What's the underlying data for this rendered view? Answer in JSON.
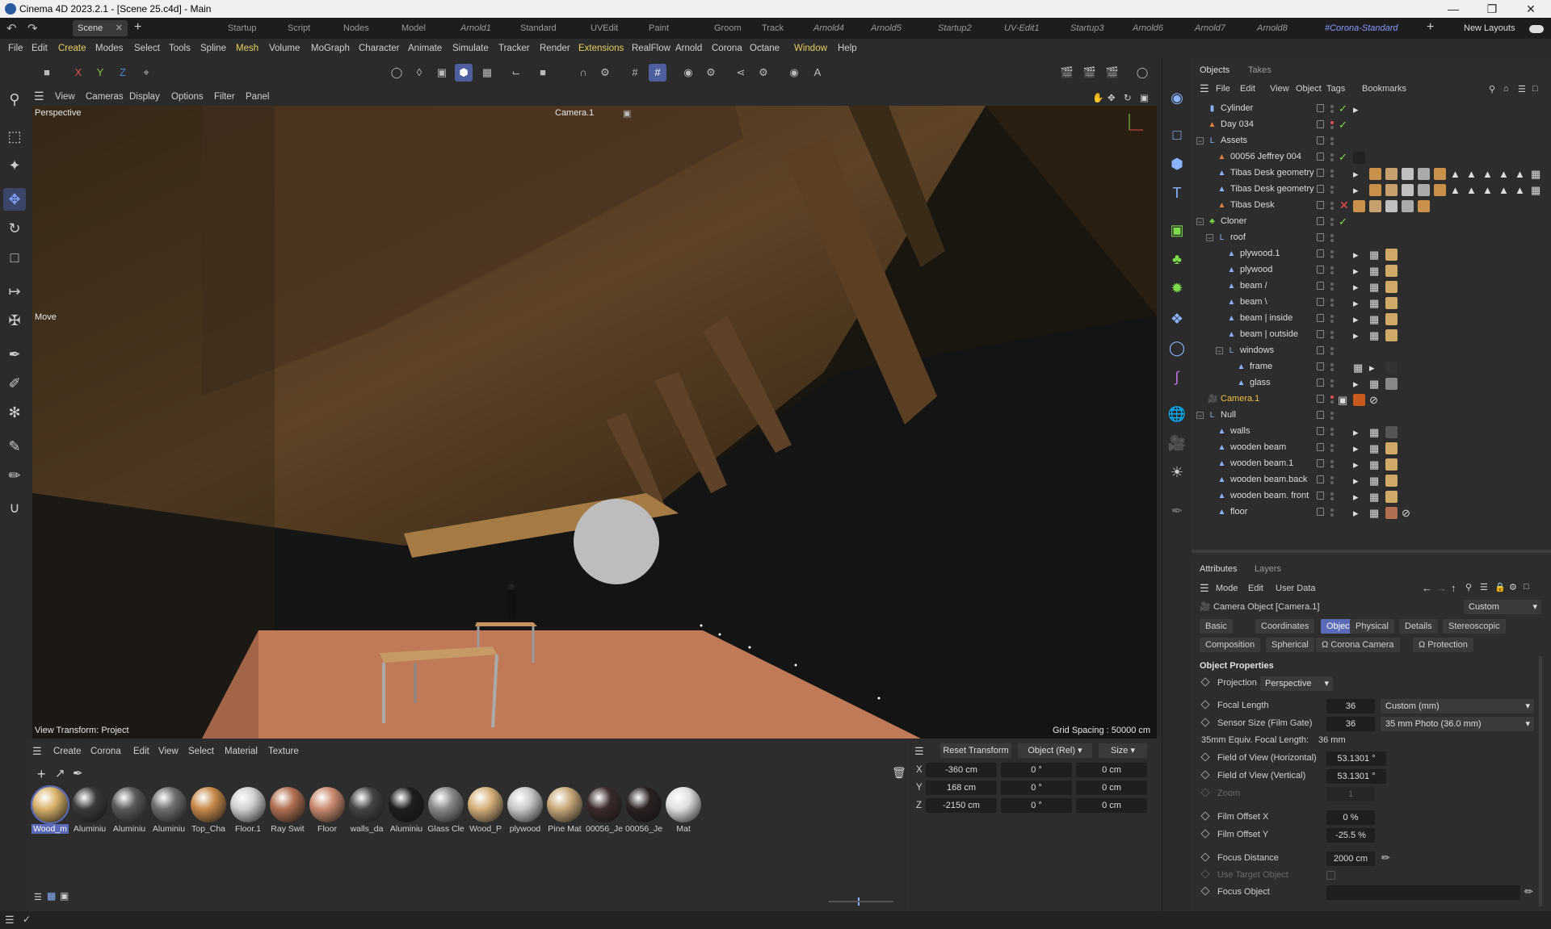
{
  "window": {
    "title": "Cinema 4D 2023.2.1 - [Scene 25.c4d] - Main"
  },
  "doc_tab": "Scene 25.c4d",
  "layouts": [
    "Startup",
    "Script",
    "Nodes",
    "Model",
    "Arnold1",
    "Standard",
    "UVEdit",
    "Paint",
    "Groom",
    "Track",
    "Arnold4",
    "Arnold5",
    "Startup2",
    "UV-Edit1",
    "Startup3",
    "Arnold6",
    "Arnold7",
    "Arnold8",
    "#Corona-Standard"
  ],
  "new_layouts": "New Layouts",
  "menus": [
    "File",
    "Edit",
    "Create",
    "Modes",
    "Select",
    "Tools",
    "Spline",
    "Mesh",
    "Volume",
    "MoGraph",
    "Character",
    "Animate",
    "Simulate",
    "Tracker",
    "Render",
    "Extensions",
    "RealFlow",
    "Arnold",
    "Corona",
    "Octane",
    "Window",
    "Help"
  ],
  "viewport_menu": [
    "View",
    "Cameras",
    "Display",
    "Options",
    "Filter",
    "Panel"
  ],
  "viewport": {
    "projection": "Perspective",
    "camera": "Camera.1",
    "tool": "Move",
    "view_transform": "View Transform: Project",
    "grid_spacing": "Grid Spacing : 50000 cm"
  },
  "objects": {
    "tabs": [
      "Objects",
      "Takes"
    ],
    "menu": [
      "File",
      "Edit",
      "View",
      "Object",
      "Tags",
      "Bookmarks"
    ],
    "rows": [
      {
        "name": "Cylinder",
        "indent": 0
      },
      {
        "name": "Day 034",
        "indent": 0
      },
      {
        "name": "Assets",
        "indent": 0
      },
      {
        "name": "00056 Jeffrey 004",
        "indent": 1
      },
      {
        "name": "Tibas Desk geometry",
        "indent": 1
      },
      {
        "name": "Tibas Desk geometry",
        "indent": 1
      },
      {
        "name": "Tibas Desk",
        "indent": 1
      },
      {
        "name": "Cloner",
        "indent": 0
      },
      {
        "name": "roof",
        "indent": 1
      },
      {
        "name": "plywood.1",
        "indent": 2
      },
      {
        "name": "plywood",
        "indent": 2
      },
      {
        "name": "beam /",
        "indent": 2
      },
      {
        "name": "beam \\",
        "indent": 2
      },
      {
        "name": "beam | inside",
        "indent": 2
      },
      {
        "name": "beam | outside",
        "indent": 2
      },
      {
        "name": "windows",
        "indent": 2
      },
      {
        "name": "frame",
        "indent": 3
      },
      {
        "name": "glass",
        "indent": 3
      },
      {
        "name": "Camera.1",
        "indent": 0
      },
      {
        "name": "Null",
        "indent": 0
      },
      {
        "name": "walls",
        "indent": 1
      },
      {
        "name": "wooden beam",
        "indent": 1
      },
      {
        "name": "wooden beam.1",
        "indent": 1
      },
      {
        "name": "wooden beam.back",
        "indent": 1
      },
      {
        "name": "wooden beam. front",
        "indent": 1
      },
      {
        "name": "floor",
        "indent": 1
      }
    ]
  },
  "attributes": {
    "tabs": [
      "Attributes",
      "Layers"
    ],
    "menu": [
      "Mode",
      "Edit",
      "User Data"
    ],
    "object_title": "Camera Object [Camera.1]",
    "preset": "Custom",
    "section_tabs_row1": [
      "Basic",
      "Coordinates",
      "Object",
      "Physical",
      "Details",
      "Stereoscopic"
    ],
    "section_tabs_row2": [
      "Composition",
      "Spherical",
      "Ω Corona Camera",
      "Ω Protection"
    ],
    "section_title": "Object Properties",
    "projection_label": "Projection",
    "projection_value": "Perspective",
    "focal_length_label": "Focal Length",
    "focal_length": "36",
    "focal_length_unit": "Custom (mm)",
    "sensor_label": "Sensor Size (Film Gate)",
    "sensor": "36",
    "sensor_preset": "35 mm Photo (36.0 mm)",
    "equiv_label": "35mm Equiv. Focal Length:",
    "equiv_value": "36 mm",
    "fov_h_label": "Field of View (Horizontal)",
    "fov_h": "53.1301 °",
    "fov_v_label": "Field of View (Vertical)",
    "fov_v": "53.1301 °",
    "zoom_label": "Zoom",
    "zoom": "1",
    "film_x_label": "Film Offset X",
    "film_x": "0 %",
    "film_y_label": "Film Offset Y",
    "film_y": "-25.5 %",
    "focus_dist_label": "Focus Distance",
    "focus_dist": "2000 cm",
    "use_target_label": "Use Target Object",
    "focus_obj_label": "Focus Object"
  },
  "materials": {
    "menu": [
      "Create",
      "Corona",
      "Edit",
      "View",
      "Select",
      "Material",
      "Texture"
    ],
    "items": [
      {
        "label": "Wood_m",
        "color": "#d9b26a"
      },
      {
        "label": "Aluminiu",
        "color": "#3a3a3a"
      },
      {
        "label": "Aluminiu",
        "color": "#5a5a5a"
      },
      {
        "label": "Aluminiu",
        "color": "#6e6e6e"
      },
      {
        "label": "Top_Cha",
        "color": "#c78a4a"
      },
      {
        "label": "Floor.1",
        "color": "#cfcfcf"
      },
      {
        "label": "Ray Swit",
        "color": "#b06f50"
      },
      {
        "label": "Floor",
        "color": "#c98a6e"
      },
      {
        "label": "walls_da",
        "color": "#444444"
      },
      {
        "label": "Aluminiu",
        "color": "#1e1e1e"
      },
      {
        "label": "Glass Cle",
        "color": "#8a8a8a"
      },
      {
        "label": "Wood_P",
        "color": "#d6b07a"
      },
      {
        "label": "plywood",
        "color": "#c9c9c9"
      },
      {
        "label": "Pine Mat",
        "color": "#c9a97a"
      },
      {
        "label": "00056_Je",
        "color": "#3b2a2a"
      },
      {
        "label": "00056_Je",
        "color": "#2a2020"
      },
      {
        "label": "Mat",
        "color": "#e0e0e0"
      }
    ]
  },
  "coordinates": {
    "reset": "Reset Transform",
    "mode": "Object (Rel)",
    "size": "Size",
    "rows": [
      {
        "axis": "X",
        "pos": "-360 cm",
        "rot": "0 °",
        "size": "0 cm"
      },
      {
        "axis": "Y",
        "pos": "168 cm",
        "rot": "0 °",
        "size": "0 cm"
      },
      {
        "axis": "Z",
        "pos": "-2150 cm",
        "rot": "0 °",
        "size": "0 cm"
      }
    ]
  }
}
